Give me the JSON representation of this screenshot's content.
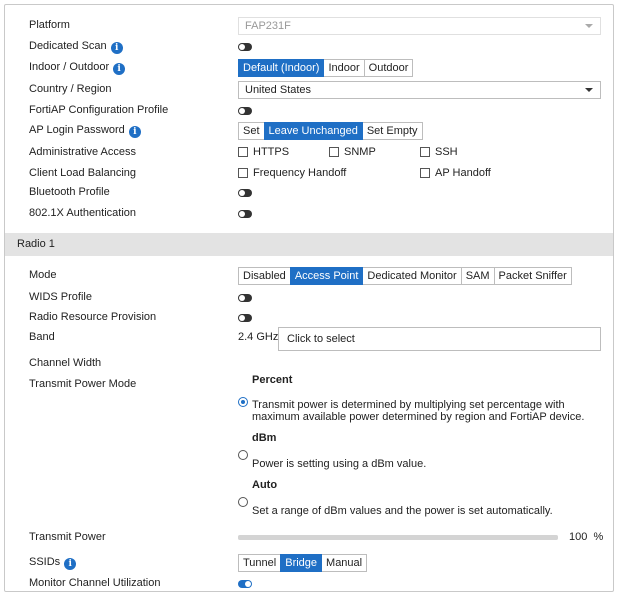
{
  "platform": {
    "label": "Platform",
    "value": "FAP231F"
  },
  "dedicated_scan": {
    "label": "Dedicated Scan"
  },
  "indoor_outdoor": {
    "label": "Indoor / Outdoor",
    "options": [
      "Default (Indoor)",
      "Indoor",
      "Outdoor"
    ],
    "selected": "Default (Indoor)"
  },
  "country_region": {
    "label": "Country / Region",
    "value": "United States"
  },
  "config_profile": {
    "label": "FortiAP Configuration Profile"
  },
  "ap_login_password": {
    "label": "AP Login Password",
    "options": [
      "Set",
      "Leave Unchanged",
      "Set Empty"
    ],
    "selected": "Leave Unchanged"
  },
  "admin_access": {
    "label": "Administrative Access",
    "options": [
      "HTTPS",
      "SNMP",
      "SSH"
    ]
  },
  "client_load_balancing": {
    "label": "Client Load Balancing",
    "options": [
      "Frequency Handoff",
      "AP Handoff"
    ]
  },
  "bluetooth_profile": {
    "label": "Bluetooth Profile"
  },
  "dot1x_auth": {
    "label": "802.1X Authentication"
  },
  "radio_section": {
    "title": "Radio 1"
  },
  "mode": {
    "label": "Mode",
    "options": [
      "Disabled",
      "Access Point",
      "Dedicated Monitor",
      "SAM",
      "Packet Sniffer"
    ],
    "selected": "Access Point"
  },
  "wids_profile": {
    "label": "WIDS Profile"
  },
  "radio_resource_provision": {
    "label": "Radio Resource Provision"
  },
  "band": {
    "label": "Band",
    "value": "2.4 GHz",
    "select_text": "Click to select"
  },
  "channel_width": {
    "label": "Channel Width"
  },
  "transmit_power_mode": {
    "label": "Transmit Power Mode",
    "options": [
      {
        "title": "Percent",
        "description": "Transmit power is determined by multiplying set percentage with maximum available power determined by region and FortiAP device."
      },
      {
        "title": "dBm",
        "description": "Power is setting using a dBm value."
      },
      {
        "title": "Auto",
        "description": "Set a range of dBm values and the power is set automatically."
      }
    ],
    "selected": "Percent"
  },
  "transmit_power": {
    "label": "Transmit Power",
    "value": 100,
    "value_text": "100",
    "unit": "%"
  },
  "ssids": {
    "label": "SSIDs",
    "options": [
      "Tunnel",
      "Bridge",
      "Manual"
    ],
    "selected": "Bridge"
  },
  "monitor_channel_utilization": {
    "label": "Monitor Channel Utilization"
  },
  "colors": {
    "accent": "#1f6fc5",
    "section_bg": "#e3e3e3"
  }
}
